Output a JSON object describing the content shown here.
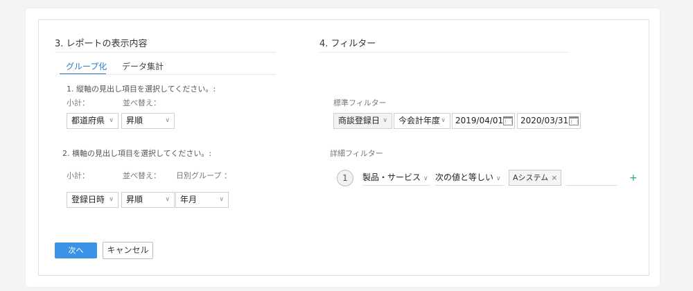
{
  "report_section": {
    "title": "3. レポートの表示内容",
    "tabs": [
      {
        "label": "グループ化",
        "active": true
      },
      {
        "label": "データ集計",
        "active": false
      }
    ],
    "row_group": {
      "heading": "1. 縦軸の見出し項目を選択してください。:",
      "subtotal_label": "小計：",
      "sort_label": "並べ替え：",
      "subtotal_value": "都道府県",
      "sort_value": "昇順"
    },
    "column_group": {
      "heading": "2. 横軸の見出し項目を選択してください。:",
      "subtotal_label": "小計：",
      "sort_label": "並べ替え：",
      "date_group_label": "日別グループ ：",
      "subtotal_value": "登録日時",
      "sort_value": "昇順",
      "date_group_value": "年月"
    }
  },
  "filter_section": {
    "title": "4. フィルター",
    "standard": {
      "label": "標準フィルター",
      "field_value": "商談登録日",
      "period_value": "今会計年度",
      "start_date": "2019/04/01",
      "end_date": "2020/03/31"
    },
    "detail": {
      "label": "詳細フィルター",
      "rows": [
        {
          "number": "1",
          "field": "製品・サービス",
          "operator": "次の値と等しい",
          "value_chip": "Aシステム",
          "remove_symbol": "×"
        }
      ],
      "add_symbol": "+"
    }
  },
  "buttons": {
    "next": "次へ",
    "cancel": "キャンセル"
  },
  "colors": {
    "accent": "#2a7cc7",
    "primary_button": "#3a93e6",
    "add_icon": "#2aa58a"
  },
  "icons": {
    "dropdown": "chevron-down-icon",
    "calendar": "calendar-icon",
    "remove": "close-icon",
    "add": "plus-icon"
  }
}
